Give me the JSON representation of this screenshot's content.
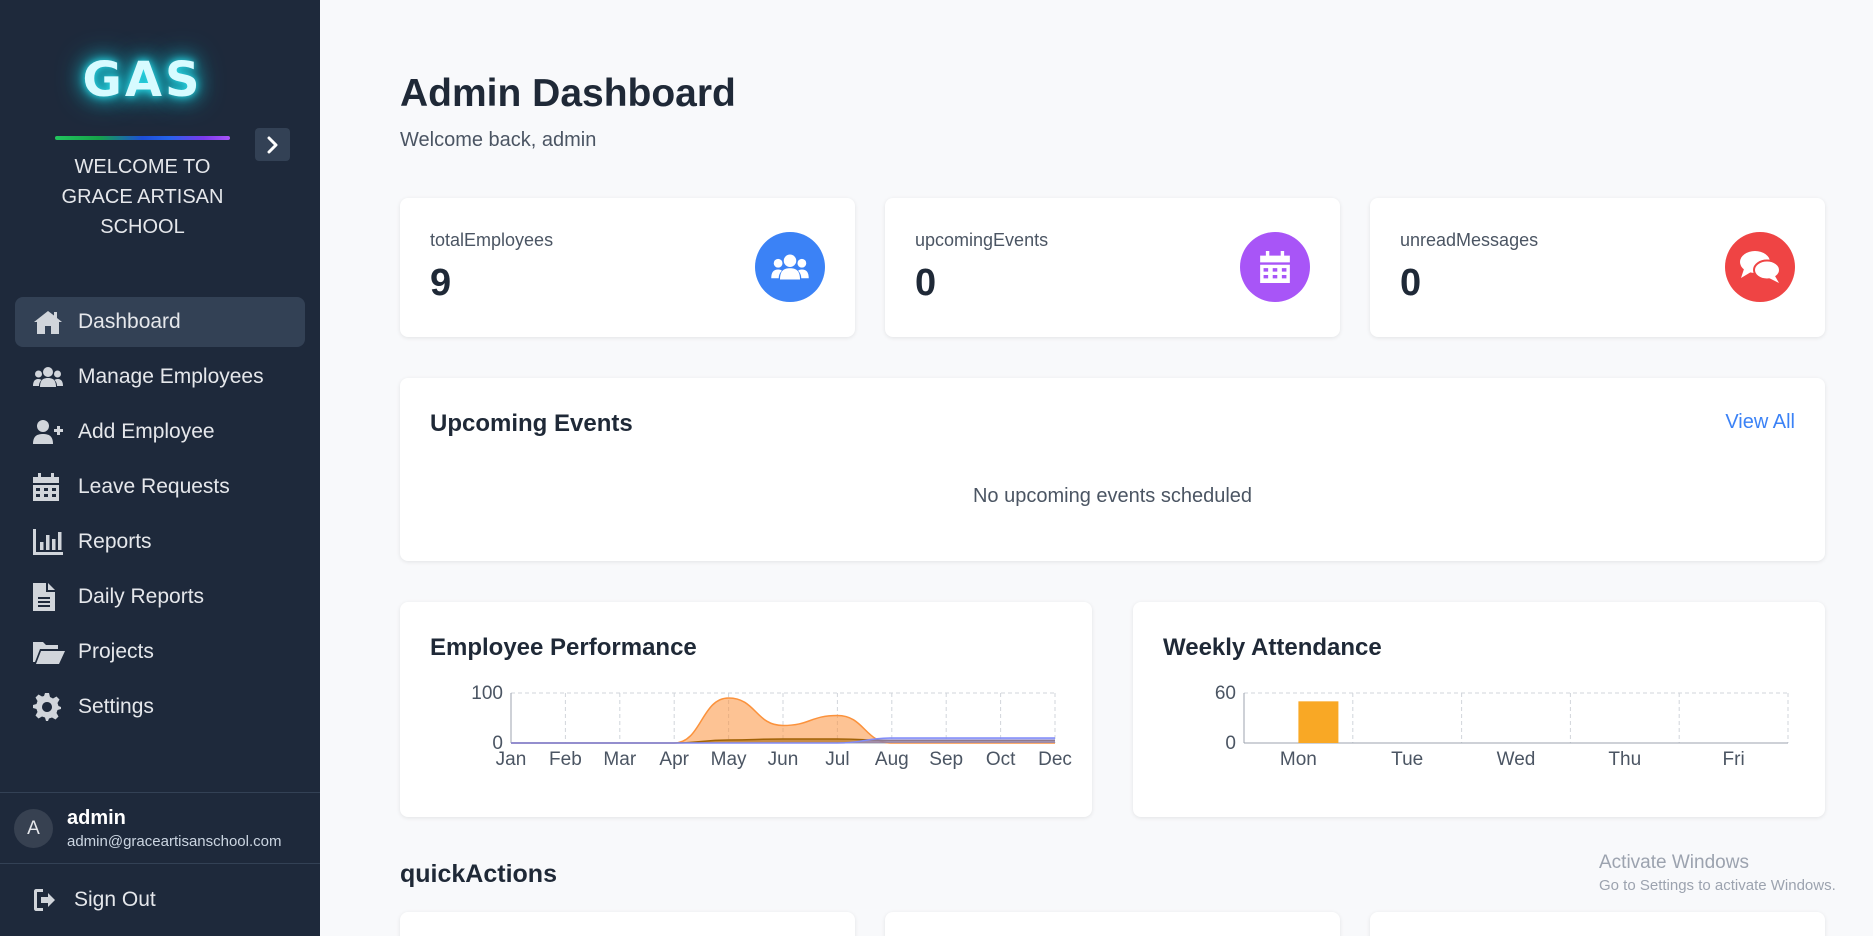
{
  "sidebar": {
    "logo": "GAS",
    "welcome": "WELCOME TO GRACE ARTISAN SCHOOL",
    "items": [
      {
        "label": "Dashboard",
        "icon": "home-icon",
        "active": true
      },
      {
        "label": "Manage Employees",
        "icon": "users-icon"
      },
      {
        "label": "Add Employee",
        "icon": "user-plus-icon"
      },
      {
        "label": "Leave Requests",
        "icon": "calendar-icon"
      },
      {
        "label": "Reports",
        "icon": "bar-chart-icon"
      },
      {
        "label": "Daily Reports",
        "icon": "file-text-icon"
      },
      {
        "label": "Projects",
        "icon": "folder-open-icon"
      },
      {
        "label": "Settings",
        "icon": "gear-icon"
      }
    ],
    "user": {
      "initial": "A",
      "name": "admin",
      "email": "admin@graceartisanschool.com"
    },
    "signout": "Sign Out"
  },
  "header": {
    "title": "Admin Dashboard",
    "subtitle": "Welcome back, admin"
  },
  "stats": [
    {
      "label": "totalEmployees",
      "value": "9",
      "color": "#3b82f6",
      "icon": "users-icon"
    },
    {
      "label": "upcomingEvents",
      "value": "0",
      "color": "#a855f7",
      "icon": "calendar-icon"
    },
    {
      "label": "unreadMessages",
      "value": "0",
      "color": "#ef4444",
      "icon": "comments-icon"
    }
  ],
  "events": {
    "title": "Upcoming Events",
    "view_all": "View All",
    "empty": "No upcoming events scheduled"
  },
  "performance": {
    "title": "Employee Performance"
  },
  "attendance": {
    "title": "Weekly Attendance"
  },
  "quick_actions": {
    "title": "quickActions"
  },
  "watermark": {
    "line1": "Activate Windows",
    "line2": "Go to Settings to activate Windows."
  },
  "chart_data": [
    {
      "type": "area",
      "title": "Employee Performance",
      "categories": [
        "Jan",
        "Feb",
        "Mar",
        "Apr",
        "May",
        "Jun",
        "Jul",
        "Aug",
        "Sep",
        "Oct",
        "Dec"
      ],
      "ylim": [
        0,
        100
      ],
      "yticks": [
        0,
        100
      ],
      "grid": true,
      "series": [
        {
          "color": "#fb923c",
          "values": [
            0,
            0,
            0,
            0,
            90,
            35,
            55,
            0,
            0,
            0,
            0
          ]
        },
        {
          "color": "#a16207",
          "values": [
            0,
            0,
            0,
            0,
            6,
            8,
            8,
            5,
            5,
            5,
            5
          ]
        },
        {
          "color": "#818cf8",
          "values": [
            0,
            0,
            0,
            0,
            0,
            0,
            0,
            10,
            10,
            10,
            10
          ]
        }
      ]
    },
    {
      "type": "bar",
      "title": "Weekly Attendance",
      "categories": [
        "Mon",
        "Tue",
        "Wed",
        "Thu",
        "Fri"
      ],
      "values": [
        50,
        0,
        0,
        0,
        0
      ],
      "ylim": [
        0,
        60
      ],
      "yticks": [
        0,
        60
      ],
      "grid": true,
      "color": "#f9a825"
    }
  ]
}
